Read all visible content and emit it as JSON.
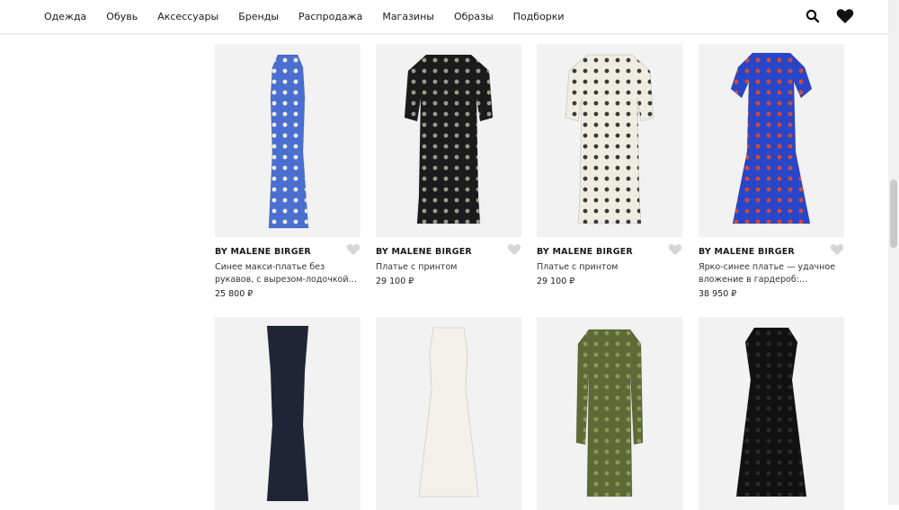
{
  "nav": {
    "items": [
      {
        "label": "Одежда"
      },
      {
        "label": "Обувь"
      },
      {
        "label": "Аксессуары"
      },
      {
        "label": "Бренды"
      },
      {
        "label": "Распродажа"
      },
      {
        "label": "Магазины"
      },
      {
        "label": "Образы"
      },
      {
        "label": "Подборки"
      }
    ],
    "icons": [
      "search-icon",
      "heart-icon"
    ]
  },
  "products": [
    {
      "brand": "BY MALENE BIRGER",
      "title": "Синее макси-платье без рукавов, с вырезом-лодочкой сшито из...",
      "price": "25 800 ₽",
      "colors": {
        "bg": "#4a6fd1",
        "print": "#f4f0dc"
      }
    },
    {
      "brand": "BY MALENE BIRGER",
      "title": "Платье с принтом",
      "price": "29 100 ₽",
      "colors": {
        "bg": "#1b1b1b",
        "print": "#9a9a8a"
      }
    },
    {
      "brand": "BY MALENE BIRGER",
      "title": "Платье с принтом",
      "price": "29 100 ₽",
      "colors": {
        "bg": "#efece2",
        "print": "#3a3a3a"
      }
    },
    {
      "brand": "BY MALENE BIRGER",
      "title": "Ярко-синее платье — удачное вложение в гардероб: свободн...",
      "price": "38 950 ₽",
      "colors": {
        "bg": "#2a46c8",
        "print": "#d24b3a"
      }
    },
    {
      "brand": "",
      "title": "",
      "price": "",
      "colors": {
        "bg": "#1f2436",
        "print": "#1f2436"
      }
    },
    {
      "brand": "",
      "title": "",
      "price": "",
      "colors": {
        "bg": "#f3f1ea",
        "print": "#f3f1ea"
      }
    },
    {
      "brand": "",
      "title": "",
      "price": "",
      "colors": {
        "bg": "#5d6a36",
        "print": "#8a9a55"
      }
    },
    {
      "brand": "",
      "title": "",
      "price": "",
      "colors": {
        "bg": "#111111",
        "print": "#2b2b2b"
      }
    }
  ]
}
